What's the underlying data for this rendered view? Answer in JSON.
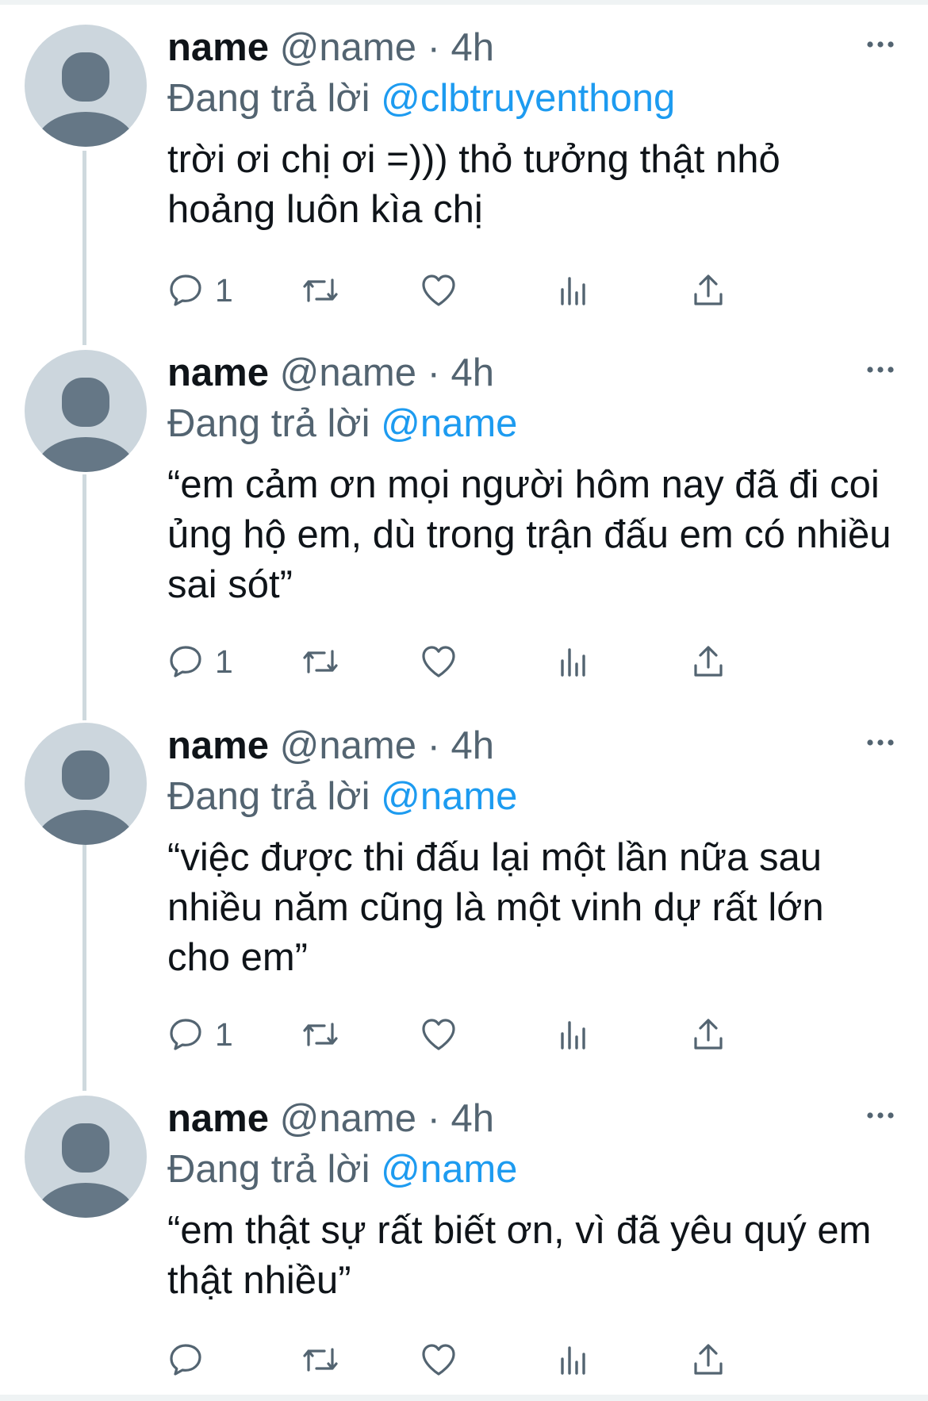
{
  "colors": {
    "accent": "#1d9bf0",
    "secondary_text": "#536471",
    "primary_text": "#0f1419",
    "thread_line": "#cfd9de",
    "avatar_bg": "#ccd6dd",
    "avatar_fg": "#657786"
  },
  "icons": [
    "avatar-placeholder-icon",
    "more-icon",
    "reply-icon",
    "retweet-icon",
    "like-icon",
    "views-icon",
    "share-icon"
  ],
  "tweets": [
    {
      "name": "name",
      "handle": "@name",
      "separator": "·",
      "time": "4h",
      "replying_label": "Đang trả lời",
      "replying_to": "@clbtruyenthong",
      "text": "trời ơi chị ơi =))) thỏ tưởng thật nhỏ hoảng luôn kìa chị",
      "reply_count": "1"
    },
    {
      "name": "name",
      "handle": "@name",
      "separator": "·",
      "time": "4h",
      "replying_label": "Đang trả lời",
      "replying_to": "@name",
      "text": "“em cảm ơn mọi người hôm nay đã đi coi ủng hộ em, dù trong trận đấu em có nhiều sai sót”",
      "reply_count": "1"
    },
    {
      "name": "name",
      "handle": "@name",
      "separator": "·",
      "time": "4h",
      "replying_label": "Đang trả lời",
      "replying_to": "@name",
      "text": "“việc được thi đấu lại một lần nữa sau nhiều năm cũng là một vinh dự rất lớn cho em”",
      "reply_count": "1"
    },
    {
      "name": "name",
      "handle": "@name",
      "separator": "·",
      "time": "4h",
      "replying_label": "Đang trả lời",
      "replying_to": "@name",
      "text": "“em thật sự rất biết ơn, vì đã yêu quý em thật nhiều”",
      "reply_count": ""
    }
  ]
}
